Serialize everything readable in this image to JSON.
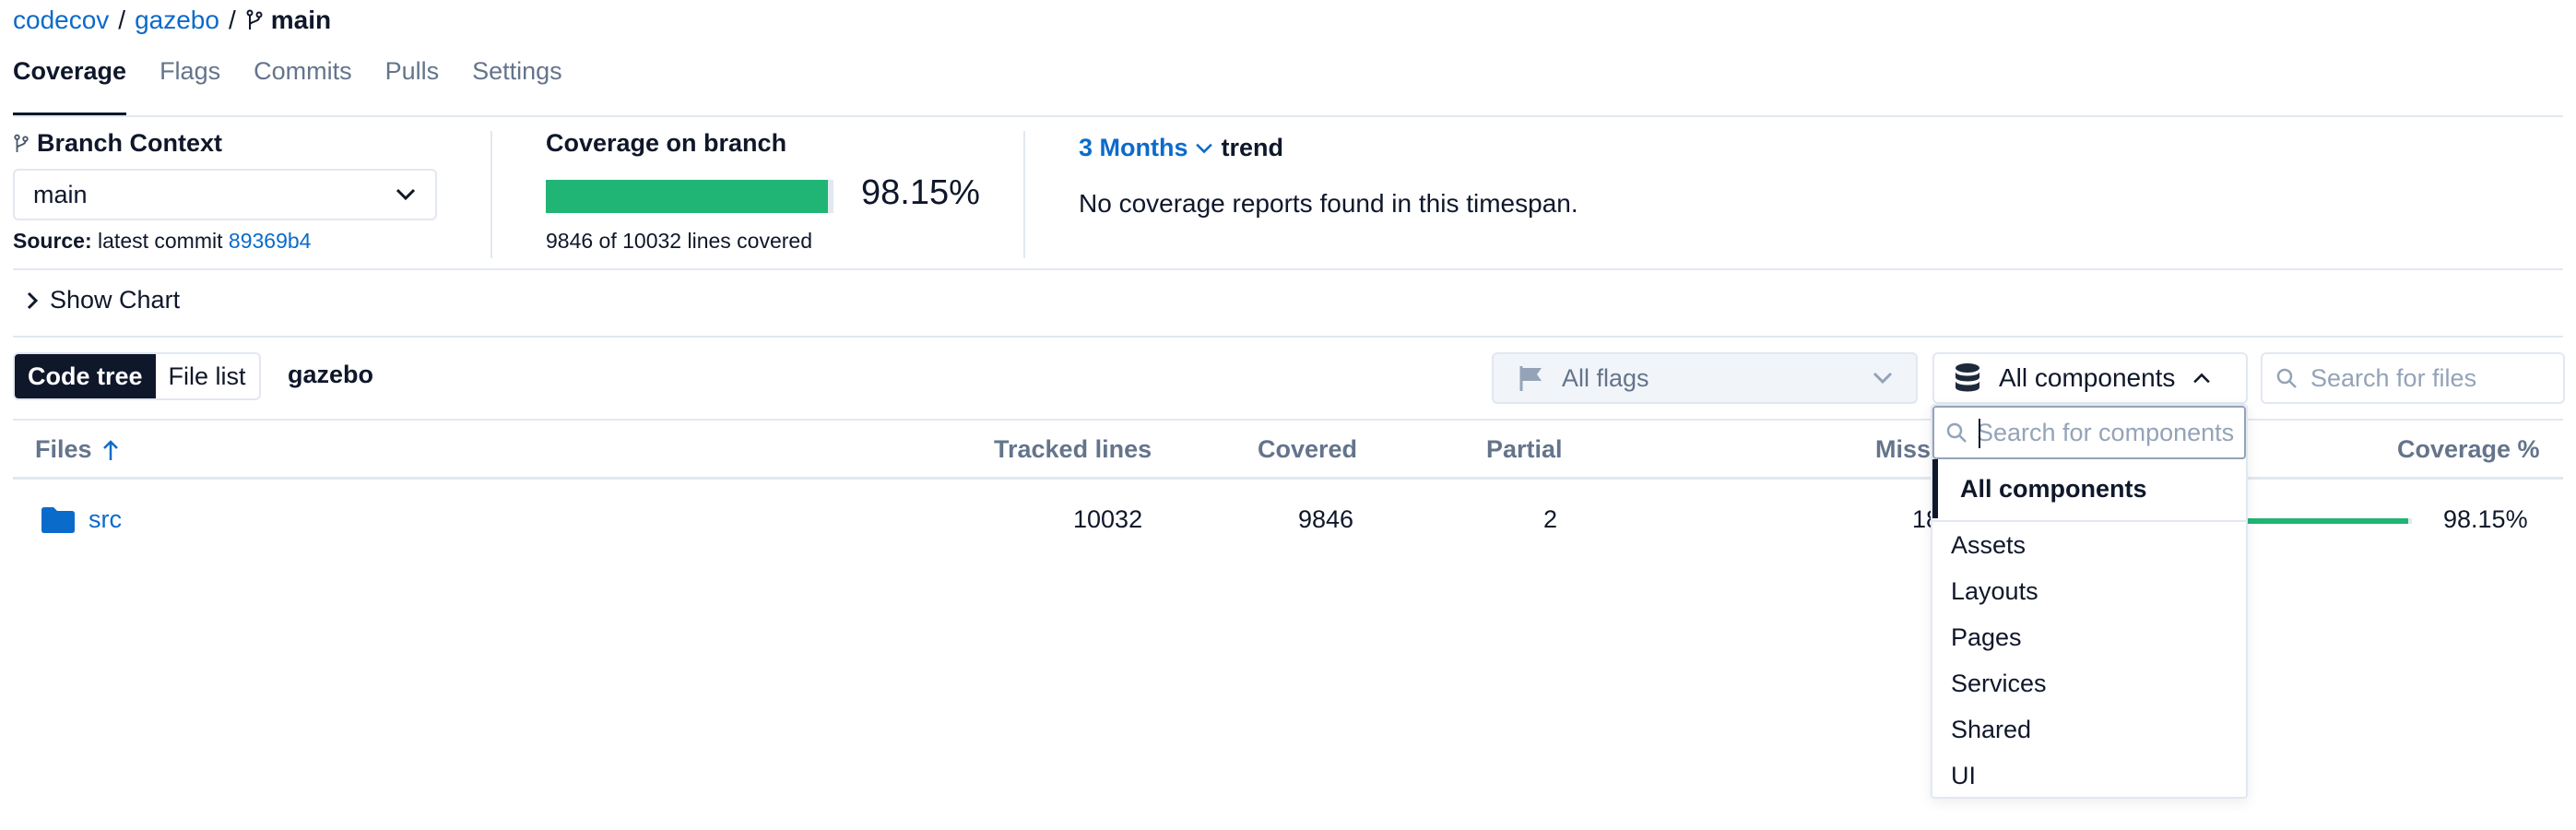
{
  "breadcrumb": {
    "org": "codecov",
    "repo": "gazebo",
    "branch": "main",
    "separator": "/"
  },
  "tabs": [
    {
      "label": "Coverage",
      "active": true
    },
    {
      "label": "Flags"
    },
    {
      "label": "Commits"
    },
    {
      "label": "Pulls"
    },
    {
      "label": "Settings"
    }
  ],
  "branch_context": {
    "title": "Branch Context",
    "selected": "main",
    "source_label": "Source:",
    "source_text": "latest commit",
    "commit": "89369b4"
  },
  "coverage": {
    "title": "Coverage on branch",
    "percent": "98.15%",
    "percent_value": 98.15,
    "lines": "9846 of 10032 lines covered"
  },
  "trend": {
    "range": "3 Months",
    "label": "trend",
    "empty": "No coverage reports found in this timespan."
  },
  "show_chart": "Show Chart",
  "toolbar": {
    "view_code_tree": "Code tree",
    "view_file_list": "File list",
    "repo": "gazebo",
    "flags_placeholder": "All flags",
    "components_label": "All components",
    "search_files_placeholder": "Search for files"
  },
  "table": {
    "headers": {
      "files": "Files",
      "tracked": "Tracked lines",
      "covered": "Covered",
      "partial": "Partial",
      "missed": "Miss",
      "coverage": "Coverage %"
    },
    "rows": [
      {
        "name": "src",
        "tracked": "10032",
        "covered": "9846",
        "partial": "2",
        "missed": "18",
        "coverage": "98.15%"
      }
    ]
  },
  "components_dropdown": {
    "search_placeholder": "Search for components",
    "items": [
      "All components",
      "Assets",
      "Layouts",
      "Pages",
      "Services",
      "Shared",
      "UI"
    ],
    "selected": "All components"
  },
  "colors": {
    "accent": "#0b6bcb",
    "success": "#21b575",
    "dark": "#0f172a",
    "muted": "#64748b",
    "border": "#e2e8f0"
  }
}
